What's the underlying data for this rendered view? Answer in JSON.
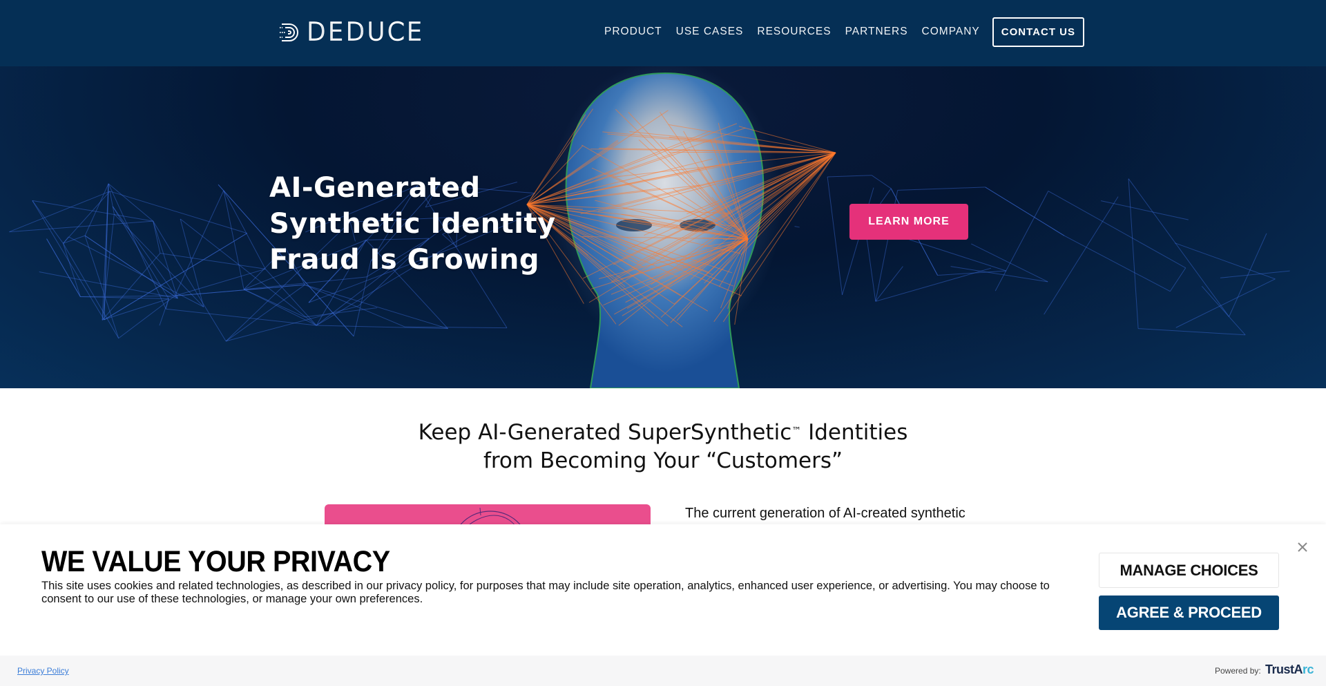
{
  "header": {
    "logo_text": "DEDUCE",
    "nav": [
      {
        "label": "PRODUCT"
      },
      {
        "label": "USE CASES"
      },
      {
        "label": "RESOURCES"
      },
      {
        "label": "PARTNERS"
      },
      {
        "label": "COMPANY"
      }
    ],
    "contact_label": "CONTACT US"
  },
  "hero": {
    "title_lines": [
      "AI-Generated",
      "Synthetic Identity",
      "Fraud Is Growing"
    ],
    "cta_label": "LEARN MORE"
  },
  "content": {
    "title_part1": "Keep AI-Generated SuperSynthetic",
    "trademark": "™",
    "title_part2": " Identities",
    "title_line2": "from Becoming Your “Customers”",
    "body_text": "The current generation of AI-created synthetic"
  },
  "cookie_banner": {
    "title": "WE VALUE YOUR PRIVACY",
    "text": "This site uses cookies and related technologies, as described in our privacy policy, for purposes that may include site operation, analytics, enhanced user experience, or advertising. You may choose to consent to our use of these technologies, or manage your own preferences.",
    "manage_label": "MANAGE CHOICES",
    "agree_label": "AGREE & PROCEED",
    "privacy_link": "Privacy Policy",
    "powered_by": "Powered by:",
    "brand_main": "TrustA",
    "brand_accent": "rc"
  },
  "colors": {
    "header_bg": "#052f55",
    "cta_pink": "#e5317a",
    "agree_blue": "#064574",
    "link_blue": "#3b7dd8"
  }
}
